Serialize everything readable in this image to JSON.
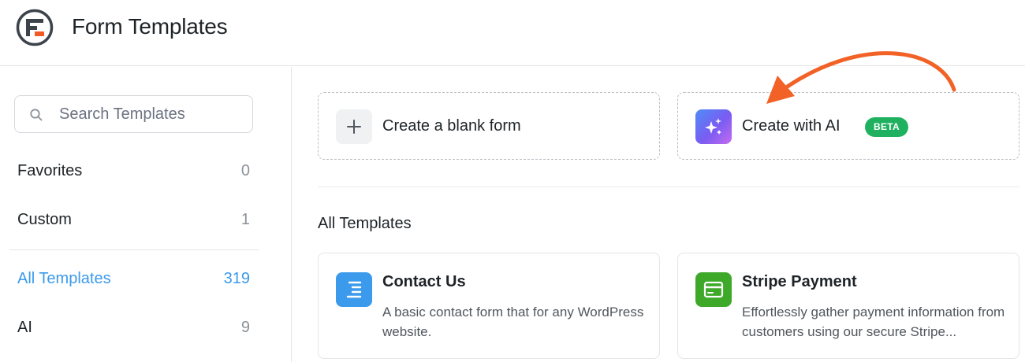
{
  "header": {
    "title": "Form Templates",
    "logo_icon": "formidable-logo-icon"
  },
  "sidebar": {
    "search_placeholder": "Search Templates",
    "categories": [
      {
        "label": "Favorites",
        "count": "0",
        "active": false
      },
      {
        "label": "Custom",
        "count": "1",
        "active": false
      },
      {
        "label": "All Templates",
        "count": "319",
        "active": true
      },
      {
        "label": "AI",
        "count": "9",
        "active": false
      }
    ]
  },
  "actions": {
    "blank": {
      "label": "Create a blank form",
      "icon": "plus-icon"
    },
    "ai": {
      "label": "Create with AI",
      "badge": "BETA",
      "icon": "sparkles-icon"
    }
  },
  "templates_section": {
    "title": "All Templates",
    "templates": [
      {
        "title": "Contact Us",
        "description": "A basic contact form that for any WordPress website.",
        "icon": "text-align-icon",
        "icon_color": "#3b9aeb"
      },
      {
        "title": "Stripe Payment",
        "description": "Effortlessly gather payment information from customers using our secure Stripe...",
        "icon": "credit-card-icon",
        "icon_color": "#3ea929"
      }
    ]
  },
  "colors": {
    "accent": "#3b9aeb",
    "beta_badge": "#1fb15f",
    "arrow": "#f26226"
  }
}
